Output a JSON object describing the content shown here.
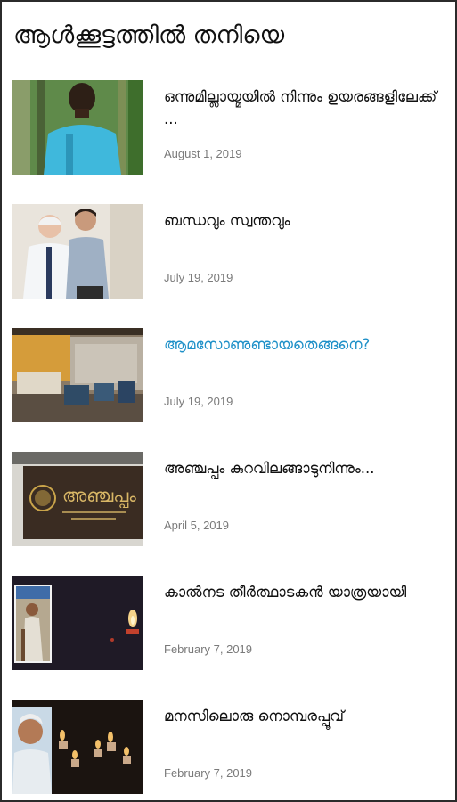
{
  "page": {
    "title": "ആൾക്കൂട്ടത്തിൽ തനിയെ"
  },
  "posts": [
    {
      "headline": "ഒന്നുമില്ലായ്മയിൽ നിന്നും ഉയരങ്ങളിലേക്ക് ...",
      "date": "August 1, 2019"
    },
    {
      "headline": "ബന്ധവും സ്വന്തവും",
      "date": "July 19, 2019"
    },
    {
      "headline": "ആമസോണുണ്ടായതെങ്ങനെ?",
      "date": "July 19, 2019"
    },
    {
      "headline": "അഞ്ചപ്പം കുറവിലങ്ങാടുനിന്നും...",
      "date": "April 5, 2019"
    },
    {
      "headline": "കാൽനട തീർത്ഥാടകൻ യാത്രയായി",
      "date": "February 7, 2019"
    },
    {
      "headline": "മനസിലൊരു നൊമ്പരപ്പൂവ്",
      "date": "February 7, 2019"
    }
  ],
  "colors": {
    "link_active": "#1e90c8",
    "date_text": "#7a7a7a",
    "title_text": "#111111"
  },
  "thumbnails": {
    "sign_text": "അഞ്ചപ്പം"
  }
}
